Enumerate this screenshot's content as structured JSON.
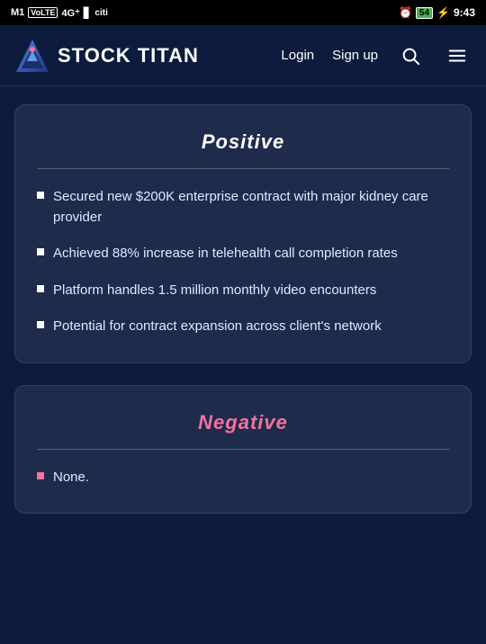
{
  "statusBar": {
    "left": "M1  VoLTE  4G+  signal  citi",
    "carrier": "M1",
    "volte": "VoLTE",
    "network": "4G+",
    "battery": "54",
    "time": "9:43"
  },
  "navbar": {
    "logoText": "STOCK TITAN",
    "loginLabel": "Login",
    "signupLabel": "Sign up"
  },
  "positiveCard": {
    "title": "Positive",
    "bullets": [
      "Secured new $200K enterprise contract with major kidney care provider",
      "Achieved 88% increase in telehealth call completion rates",
      "Platform handles 1.5 million monthly video encounters",
      "Potential for contract expansion across client's network"
    ]
  },
  "negativeCard": {
    "title": "Negative",
    "bullets": [
      "None."
    ]
  }
}
